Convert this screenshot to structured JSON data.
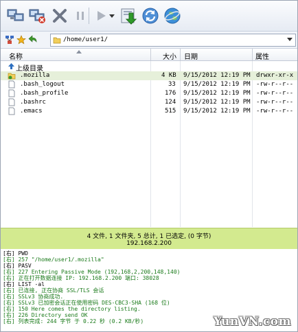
{
  "toolbar": {
    "buttons": [
      "connect-icon",
      "disconnect-icon",
      "stop-icon",
      "pause-icon",
      "play-icon",
      "play-dropdown-icon",
      "transfer-icon",
      "refresh-icon",
      "browser-icon"
    ]
  },
  "address": {
    "path": "/home/user1/"
  },
  "columns": {
    "name": "名称",
    "size": "大小",
    "date": "日期",
    "attr": "属性"
  },
  "parent_dir": "上级目录",
  "files": [
    {
      "name": ".mozilla",
      "size": "4 KB",
      "date": "9/15/2012 12:19 PM",
      "attr": "drwxr-xr-x"
    },
    {
      "name": ".bash_logout",
      "size": "33",
      "date": "9/15/2012 12:19 PM",
      "attr": "-rw-r--r--"
    },
    {
      "name": ".bash_profile",
      "size": "176",
      "date": "9/15/2012 12:19 PM",
      "attr": "-rw-r--r--"
    },
    {
      "name": ".bashrc",
      "size": "124",
      "date": "9/15/2012 12:19 PM",
      "attr": "-rw-r--r--"
    },
    {
      "name": ".emacs",
      "size": "515",
      "date": "9/15/2012 12:19 PM",
      "attr": "-rw-r--r--"
    }
  ],
  "status": {
    "summary": "4 文件, 1 文件夹, 5 总计, 1 已选定, (0 字节)",
    "host": "192.168.2.200"
  },
  "log": [
    {
      "text": "[右] PWD",
      "color": "#000000"
    },
    {
      "text": "[右] 257 \"/home/user1/.mozilla\"",
      "color": "#1a7a1a"
    },
    {
      "text": "[右] PASV",
      "color": "#000000"
    },
    {
      "text": "[右] 227 Entering Passive Mode (192,168,2,200,148,140)",
      "color": "#1a7a1a"
    },
    {
      "text": "[右] 正在打开数据连接 IP: 192.168.2.200 端口: 38028",
      "color": "#1a7a1a"
    },
    {
      "text": "[右] LIST -al",
      "color": "#000000"
    },
    {
      "text": "[右] 已连接, 正在协商 SSL/TLS 会话",
      "color": "#1a7a1a"
    },
    {
      "text": "[右] SSLv3 协商成功.",
      "color": "#1a7a1a"
    },
    {
      "text": "[右] SSLv3 已加密会话正在使用密码 DES-CBC3-SHA (168 位)",
      "color": "#1a7a1a"
    },
    {
      "text": "[右] 150 Here comes the directory listing.",
      "color": "#1a7a1a"
    },
    {
      "text": "[右] 226 Directory send OK",
      "color": "#1a7a1a"
    },
    {
      "text": "[右] 列表完成: 244 字节 于 0.22 秒 (0.2 KB/秒)",
      "color": "#1a7a1a"
    }
  ],
  "watermark": "YunVN.com"
}
